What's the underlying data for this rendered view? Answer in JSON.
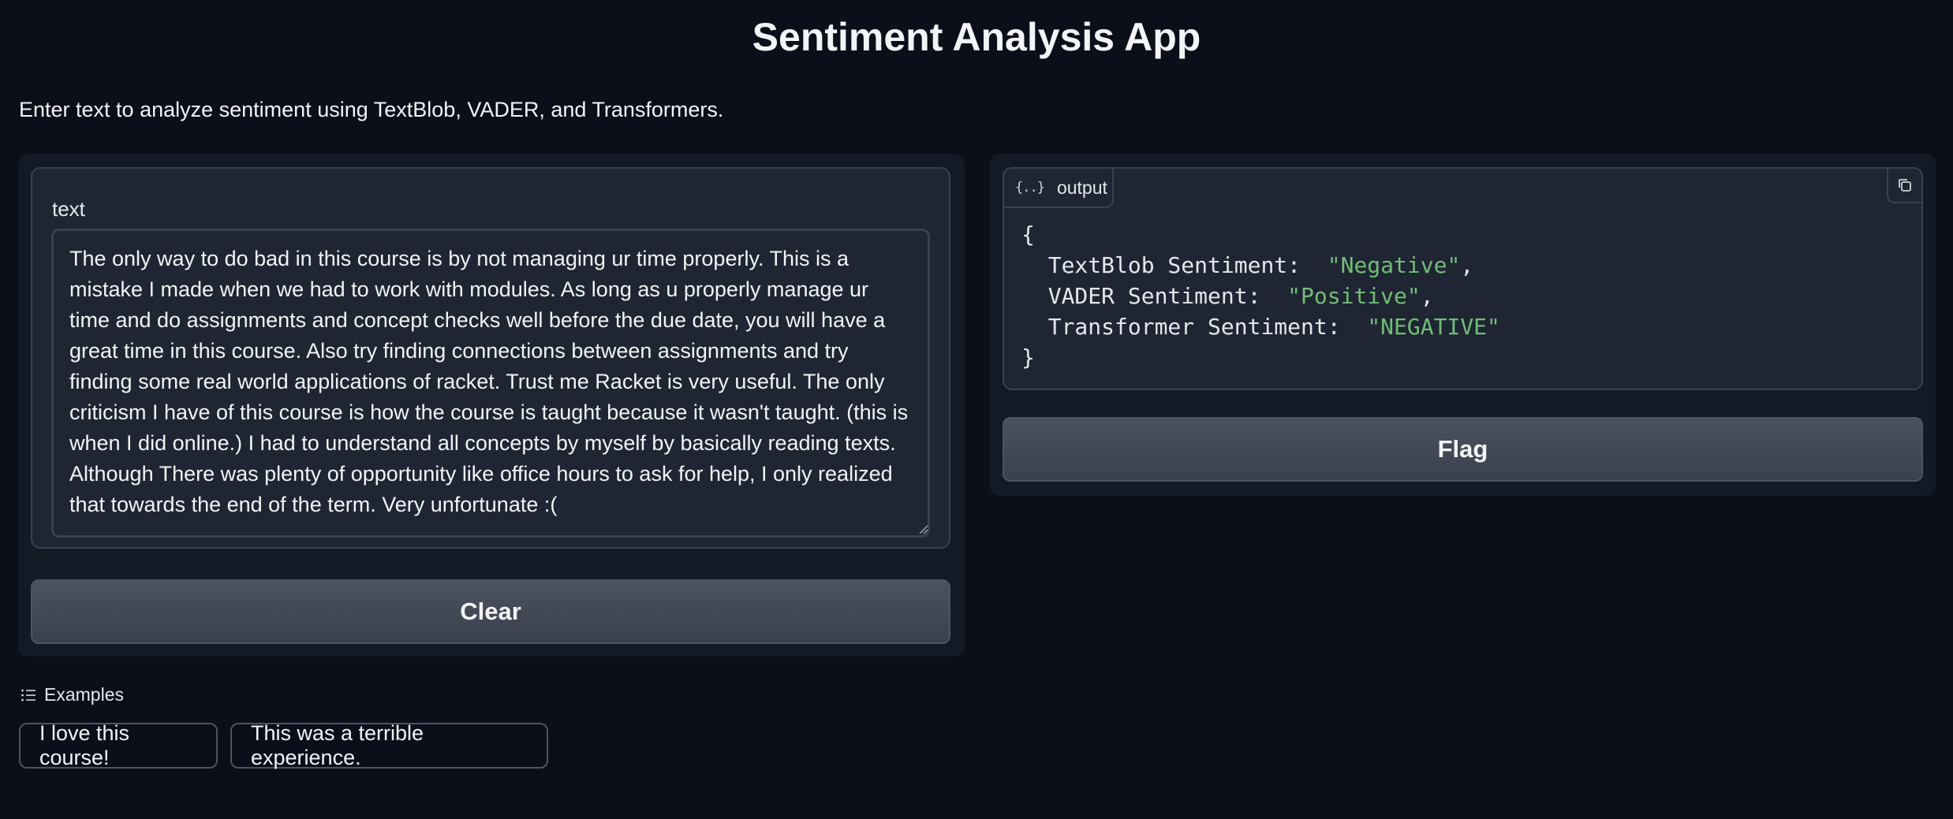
{
  "app": {
    "title": "Sentiment Analysis App",
    "description": "Enter text to analyze sentiment using TextBlob, VADER, and Transformers."
  },
  "input": {
    "label": "text",
    "value": "The only way to do bad in this course is by not managing ur time properly. This is a mistake I made when we had to work with modules. As long as u properly manage ur time and do assignments and concept checks well before the due date, you will have a great time in this course. Also try finding connections between assignments and try finding some real world applications of racket. Trust me Racket is very useful. The only criticism I have of this course is how the course is taught because it wasn't taught. (this is when I did online.) I had to understand all concepts by myself by basically reading texts. Although There was plenty of opportunity like office hours to ask for help, I only realized that towards the end of the term. Very unfortunate :("
  },
  "buttons": {
    "clear_label": "Clear",
    "flag_label": "Flag"
  },
  "output": {
    "label": "output",
    "open_brace": "{",
    "close_brace": "}",
    "entries": [
      {
        "key": "TextBlob Sentiment:",
        "value": "\"Negative\"",
        "sep": ","
      },
      {
        "key": "VADER Sentiment:",
        "value": "\"Positive\"",
        "sep": ","
      },
      {
        "key": "Transformer Sentiment:",
        "value": "\"NEGATIVE\"",
        "sep": ""
      }
    ]
  },
  "examples": {
    "header": "Examples",
    "items": [
      "I love this course!",
      "This was a terrible experience."
    ]
  },
  "colors": {
    "background": "#0b0f19",
    "panel": "#141926",
    "json_string": "#6fbf73"
  },
  "icons": [
    "braces-icon",
    "copy-icon",
    "list-icon",
    "resize-handle-icon"
  ]
}
